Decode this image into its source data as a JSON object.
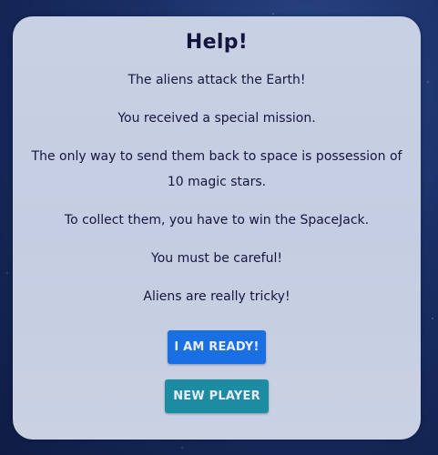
{
  "help": {
    "title": "Help!",
    "paragraphs": [
      "The aliens attack the Earth!",
      "You received a special mission.",
      "The only way to send them back to space is possession of 10 magic stars.",
      "To collect them, you have to win the SpaceJack.",
      "You must be careful!",
      "Aliens are really tricky!"
    ],
    "ready_button": "I AM READY!",
    "new_player_button": "NEW PLAYER"
  },
  "colors": {
    "ready_button": "#1a6fe3",
    "new_player_button": "#1c8ca3",
    "text": "#14153d",
    "panel": "#c6cfe2",
    "background": "#1a2f66"
  }
}
